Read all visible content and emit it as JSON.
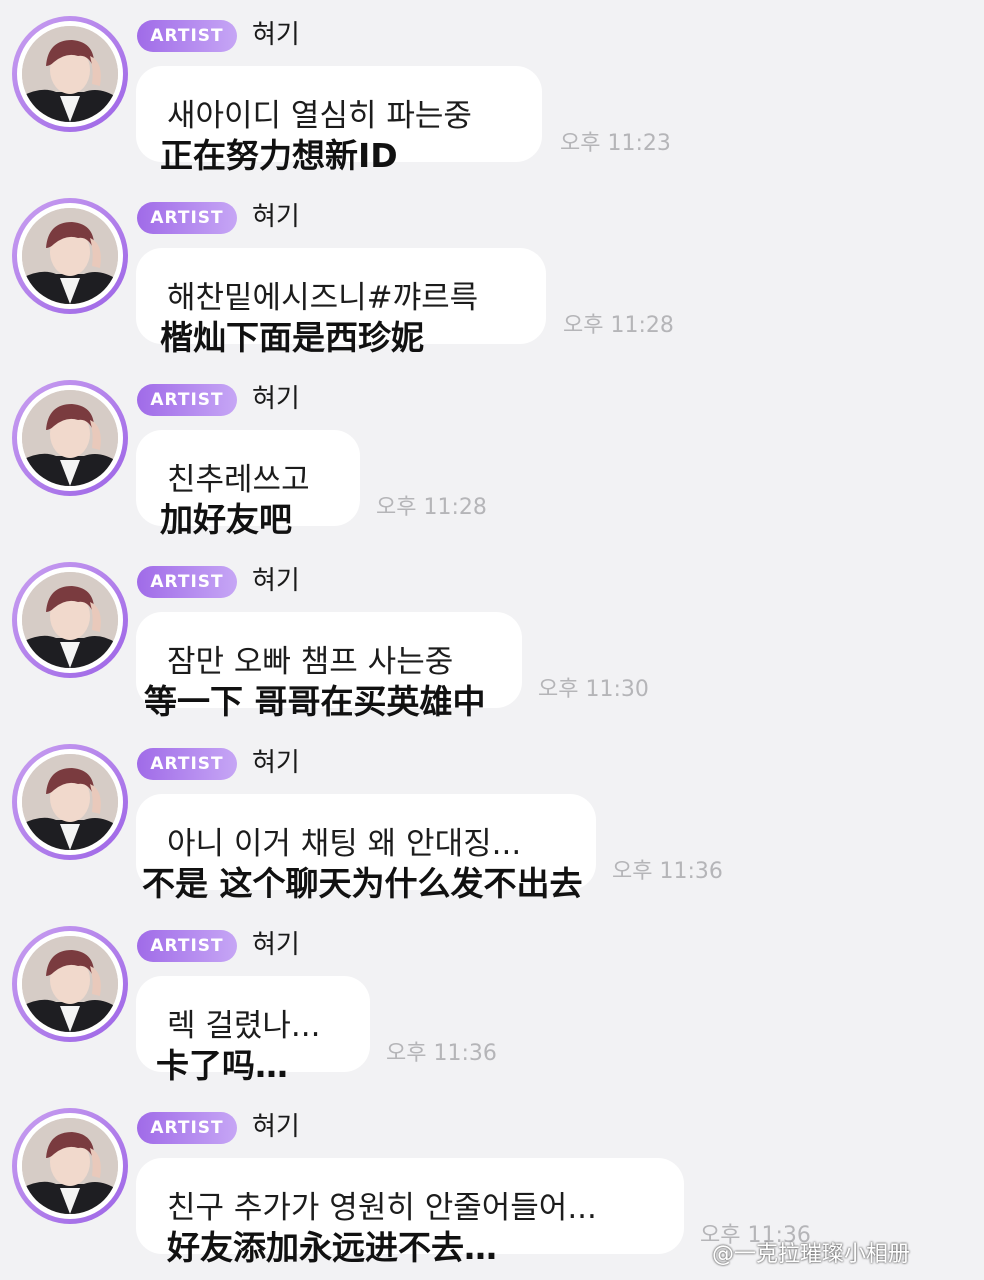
{
  "messages": [
    {
      "badge": "ARTIST",
      "name": "혀기",
      "text_kr": "새아이디 열심히 파는중",
      "text_cn": "正在努力想新ID",
      "time": "오후 11:23"
    },
    {
      "badge": "ARTIST",
      "name": "혀기",
      "text_kr": "해찬밑에시즈니#꺄르륵",
      "text_cn": "楷灿下面是西珍妮",
      "time": "오후 11:28"
    },
    {
      "badge": "ARTIST",
      "name": "혀기",
      "text_kr": "친추레쓰고",
      "text_cn": "加好友吧",
      "time": "오후 11:28"
    },
    {
      "badge": "ARTIST",
      "name": "혀기",
      "text_kr": "잠만 오빠 챔프 사는중",
      "text_cn": "等一下 哥哥在买英雄中",
      "time": "오후 11:30"
    },
    {
      "badge": "ARTIST",
      "name": "혀기",
      "text_kr": "아니 이거 채팅 왜 안대징...",
      "text_cn": "不是 这个聊天为什么发不出去",
      "time": "오후 11:36"
    },
    {
      "badge": "ARTIST",
      "name": "혀기",
      "text_kr": "렉 걸렸나...",
      "text_cn": "卡了吗…",
      "time": "오후 11:36"
    },
    {
      "badge": "ARTIST",
      "name": "혀기",
      "text_kr": "친구 추가가 영원히 안줄어들어...",
      "text_cn": "好友添加永远进不去…",
      "time": "오후 11:36"
    }
  ],
  "watermark": "@一克拉璀璨小相册",
  "colors": {
    "background": "#f2f2f4",
    "bubble": "#ffffff",
    "badge_start": "#a06be8",
    "badge_end": "#c6a6f5",
    "avatar_ring": "#9c63e6",
    "timestamp": "#b5b5b8"
  },
  "icons": {
    "avatar": "profile-photo"
  }
}
